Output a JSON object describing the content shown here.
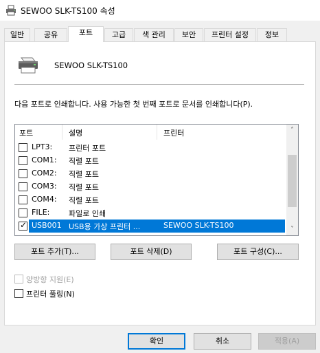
{
  "window": {
    "title": "SEWOO SLK-TS100 속성",
    "icon": "printer-icon"
  },
  "tabs": [
    {
      "label": "일반",
      "active": false
    },
    {
      "label": "공유",
      "active": false
    },
    {
      "label": "포트",
      "active": true
    },
    {
      "label": "고급",
      "active": false
    },
    {
      "label": "색 관리",
      "active": false
    },
    {
      "label": "보안",
      "active": false
    },
    {
      "label": "프린터 설정",
      "active": false
    },
    {
      "label": "정보",
      "active": false
    }
  ],
  "printer": {
    "name": "SEWOO SLK-TS100",
    "icon": "printer-icon"
  },
  "description": "다음 포트로 인쇄합니다. 사용 가능한 첫 번째 포트로 문서를 인쇄합니다(P).",
  "ports": {
    "headers": [
      "포트",
      "설명",
      "프린터"
    ],
    "rows": [
      {
        "port": "LPT3:",
        "description": "프린터 포트",
        "printer": "",
        "checked": false,
        "selected": false
      },
      {
        "port": "COM1:",
        "description": "직렬 포트",
        "printer": "",
        "checked": false,
        "selected": false
      },
      {
        "port": "COM2:",
        "description": "직렬 포트",
        "printer": "",
        "checked": false,
        "selected": false
      },
      {
        "port": "COM3:",
        "description": "직렬 포트",
        "printer": "",
        "checked": false,
        "selected": false
      },
      {
        "port": "COM4:",
        "description": "직렬 포트",
        "printer": "",
        "checked": false,
        "selected": false
      },
      {
        "port": "FILE:",
        "description": "파일로 인쇄",
        "printer": "",
        "checked": false,
        "selected": false
      },
      {
        "port": "USB001",
        "description": "USB용 가상 프린터 ...",
        "printer": "SEWOO SLK-TS100",
        "checked": true,
        "selected": true
      }
    ],
    "check_mark": "✓",
    "scroll_up": "˄",
    "scroll_down": "˅"
  },
  "port_buttons": {
    "add": "포트 추가(T)...",
    "delete": "포트 삭제(D)",
    "configure": "포트 구성(C)..."
  },
  "options": {
    "bidirectional": {
      "label": "양방향 지원(E)",
      "checked": false,
      "enabled": false
    },
    "pooling": {
      "label": "프린터 풀링(N)",
      "checked": false,
      "enabled": true
    }
  },
  "dialog_buttons": {
    "ok": "확인",
    "cancel": "취소",
    "apply": "적용(A)"
  },
  "colors": {
    "accent": "#0078d7",
    "selection": "#0078d7",
    "disabled_text": "#a0a0a0"
  }
}
